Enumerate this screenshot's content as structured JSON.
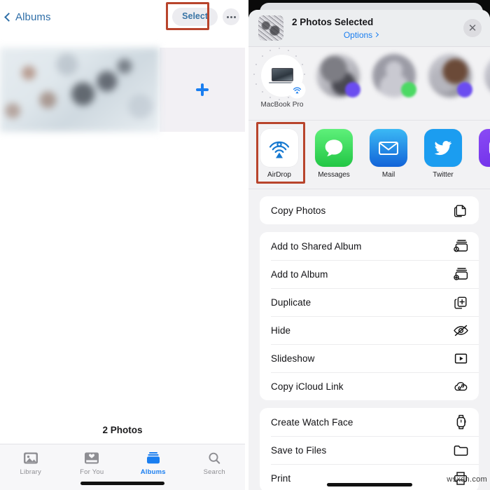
{
  "left_panel": {
    "nav": {
      "back_label": "Albums",
      "back_icon": "chevron-left-icon",
      "select_label": "Select",
      "more_icon": "ellipsis-icon"
    },
    "grid": {
      "add_icon": "plus-icon"
    },
    "photo_count": "2 Photos",
    "tabs": [
      {
        "label": "Library",
        "icon": "photos-library-icon",
        "active": false
      },
      {
        "label": "For You",
        "icon": "for-you-heart-icon",
        "active": false
      },
      {
        "label": "Albums",
        "icon": "albums-icon",
        "active": true
      },
      {
        "label": "Search",
        "icon": "search-icon",
        "active": false
      }
    ]
  },
  "share_sheet": {
    "header": {
      "title": "2 Photos Selected",
      "options_label": "Options",
      "close_icon": "close-icon"
    },
    "contacts": [
      {
        "name": "MacBook Pro",
        "kind": "device",
        "badge": "airdrop-badge",
        "blurred": false
      },
      {
        "name": "",
        "kind": "person",
        "badge": "purple-badge",
        "blurred": true
      },
      {
        "name": "",
        "kind": "person",
        "badge": "green-badge",
        "blurred": true
      },
      {
        "name": "",
        "kind": "person",
        "badge": "purple-badge",
        "blurred": true
      },
      {
        "name": "",
        "kind": "person",
        "badge": "none",
        "blurred": true
      }
    ],
    "apps": [
      {
        "label": "AirDrop",
        "icon": "airdrop-icon",
        "color": "#ffffff"
      },
      {
        "label": "Messages",
        "icon": "messages-icon",
        "color": "#4cd964"
      },
      {
        "label": "Mail",
        "icon": "mail-icon",
        "color": "#1f8ae0"
      },
      {
        "label": "Twitter",
        "icon": "twitter-icon",
        "color": "#1da1f2"
      },
      {
        "label": "",
        "icon": "instagram-icon",
        "color": "#7b3ff2"
      }
    ],
    "action_groups": [
      {
        "rows": [
          {
            "label": "Copy Photos",
            "icon": "copy-icon"
          }
        ]
      },
      {
        "rows": [
          {
            "label": "Add to Shared Album",
            "icon": "shared-album-icon"
          },
          {
            "label": "Add to Album",
            "icon": "add-album-icon"
          },
          {
            "label": "Duplicate",
            "icon": "duplicate-icon"
          },
          {
            "label": "Hide",
            "icon": "hide-eye-icon"
          },
          {
            "label": "Slideshow",
            "icon": "slideshow-icon"
          },
          {
            "label": "Copy iCloud Link",
            "icon": "icloud-link-icon"
          }
        ]
      },
      {
        "rows": [
          {
            "label": "Create Watch Face",
            "icon": "watch-icon"
          },
          {
            "label": "Save to Files",
            "icon": "folder-icon"
          },
          {
            "label": "Print",
            "icon": "printer-icon"
          }
        ]
      }
    ]
  },
  "annotations": {
    "highlight_color": "#b8442c",
    "highlighted": [
      "Select",
      "AirDrop"
    ]
  },
  "watermark": "wsxdn.com"
}
